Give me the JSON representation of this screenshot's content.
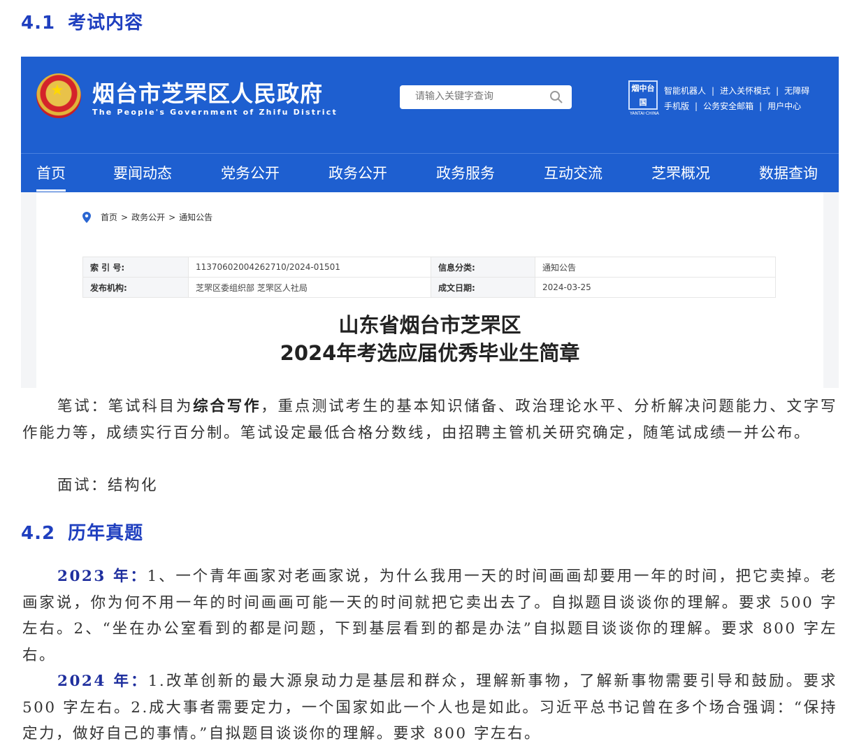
{
  "section1": {
    "num": "4.1",
    "title": "考试内容"
  },
  "section2": {
    "num": "4.2",
    "title": "历年真题"
  },
  "screenshot": {
    "gov_name": "烟台市芝罘区人民政府",
    "gov_en": "The People's Government of Zhifu District",
    "search_placeholder": "请输入关键字查询",
    "logo_text": "烟中台国",
    "logo_sub": "YANTAI·CHINA",
    "links_row1": [
      "智能机器人",
      "进入关怀模式",
      "无障碍"
    ],
    "links_row2": [
      "手机版",
      "公务安全邮箱",
      "用户中心"
    ],
    "link_sep": "|",
    "nav": [
      "首页",
      "要闻动态",
      "党务公开",
      "政务公开",
      "政务服务",
      "互动交流",
      "芝罘概况",
      "数据查询"
    ],
    "breadcrumb": [
      "首页",
      "政务公开",
      "通知公告"
    ],
    "breadcrumb_sep": ">",
    "meta": {
      "index_label": "索 引 号:",
      "index_value": "11370602004262710/2024-01501",
      "category_label": "信息分类:",
      "category_value": "通知公告",
      "publisher_label": "发布机构:",
      "publisher_value": "芝罘区委组织部 芝罘区人社局",
      "date_label": "成文日期:",
      "date_value": "2024-03-25"
    },
    "doc_title_line1": "山东省烟台市芝罘区",
    "doc_title_line2": "2024年考选应届优秀毕业生简章"
  },
  "exam": {
    "written_prefix": "笔试：笔试科目为",
    "written_subject": "综合写作",
    "written_rest": "，重点测试考生的基本知识储备、政治理论水平、分析解决问题能力、文字写作能力等，成绩实行百分制。笔试设定最低合格分数线，由招聘主管机关研究确定，随笔试成绩一并公布。",
    "interview": "面试：结构化"
  },
  "past": {
    "y2023_label": "2023 年：",
    "y2023_text": "1、一个青年画家对老画家说，为什么我用一天的时间画画却要用一年的时间，把它卖掉。老画家说，你为何不用一年的时间画画可能一天的时间就把它卖出去了。自拟题目谈谈你的理解。要求 500 字左右。2、“坐在办公室看到的都是问题，下到基层看到的都是办法”自拟题目谈谈你的理解。要求 800 字左右。",
    "y2024_label": "2024 年：",
    "y2024_text": "1.改革创新的最大源泉动力是基层和群众，理解新事物，了解新事物需要引导和鼓励。要求 500 字左右。2.成大事者需要定力，一个国家如此一个人也是如此。习近平总书记曾在多个场合强调：“保持定力，做好自己的事情。”自拟题目谈谈你的理解。要求 800 字左右。"
  },
  "colors": {
    "heading": "#1f3fbf",
    "gov_blue": "#1e5fd0",
    "year_label": "#1f2f9e"
  },
  "icons": [
    "search-icon",
    "location-pin-icon",
    "emblem-icon"
  ]
}
